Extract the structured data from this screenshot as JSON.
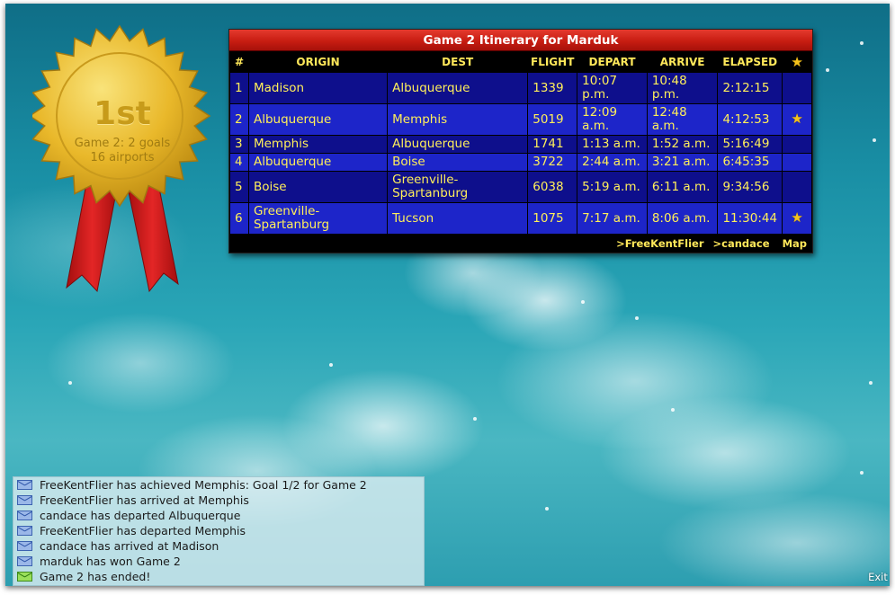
{
  "medal": {
    "rank": "1st",
    "line1": "Game 2: 2 goals",
    "line2": "16 airports",
    "colors": {
      "gold": "#e9b82a",
      "ribbon": "#d81e1e"
    },
    "icon": "gold-medal-ribbon"
  },
  "itinerary": {
    "title": "Game 2 Itinerary for Marduk",
    "headers": {
      "num": "#",
      "origin": "ORIGIN",
      "dest": "DEST",
      "flight": "FLIGHT",
      "depart": "DEPART",
      "arrive": "ARRIVE",
      "elapsed": "ELAPSED",
      "star_icon": "star-icon"
    },
    "rows": [
      {
        "num": "1",
        "origin": "Madison",
        "dest": "Albuquerque",
        "flight": "1339",
        "depart": "10:07 p.m.",
        "arrive": "10:48 p.m.",
        "elapsed": "2:12:15",
        "star": false
      },
      {
        "num": "2",
        "origin": "Albuquerque",
        "dest": "Memphis",
        "flight": "5019",
        "depart": "12:09 a.m.",
        "arrive": "12:48 a.m.",
        "elapsed": "4:12:53",
        "star": true
      },
      {
        "num": "3",
        "origin": "Memphis",
        "dest": "Albuquerque",
        "flight": "1741",
        "depart": "1:13 a.m.",
        "arrive": "1:52 a.m.",
        "elapsed": "5:16:49",
        "star": false
      },
      {
        "num": "4",
        "origin": "Albuquerque",
        "dest": "Boise",
        "flight": "3722",
        "depart": "2:44 a.m.",
        "arrive": "3:21 a.m.",
        "elapsed": "6:45:35",
        "star": false
      },
      {
        "num": "5",
        "origin": "Boise",
        "dest": "Greenville-Spartanburg",
        "flight": "6038",
        "depart": "5:19 a.m.",
        "arrive": "6:11 a.m.",
        "elapsed": "9:34:56",
        "star": false
      },
      {
        "num": "6",
        "origin": "Greenville-Spartanburg",
        "dest": "Tucson",
        "flight": "1075",
        "depart": "7:17 a.m.",
        "arrive": "8:06 a.m.",
        "elapsed": "11:30:44",
        "star": true
      }
    ],
    "footer": {
      "link1": ">FreeKentFlier",
      "link2": ">candace",
      "link3": "Map"
    },
    "colors": {
      "title_bar": "#c81d12",
      "row_dark": "#0e0f8c",
      "row_light": "#1d25c9",
      "text": "#ffef5a"
    }
  },
  "log": {
    "messages": [
      {
        "text": "FreeKentFlier has achieved Memphis: Goal 1/2 for Game 2",
        "icon": "mail-icon"
      },
      {
        "text": "FreeKentFlier has arrived at Memphis",
        "icon": "mail-icon"
      },
      {
        "text": "candace has departed Albuquerque",
        "icon": "mail-icon"
      },
      {
        "text": "FreeKentFlier has departed Memphis",
        "icon": "mail-icon"
      },
      {
        "text": "candace has arrived at Madison",
        "icon": "mail-icon"
      },
      {
        "text": "marduk has won Game 2",
        "icon": "mail-icon"
      },
      {
        "text": "Game 2 has ended!",
        "icon": "mail-icon-green"
      }
    ]
  },
  "exit_label": "Exit",
  "star_glyph": "★"
}
